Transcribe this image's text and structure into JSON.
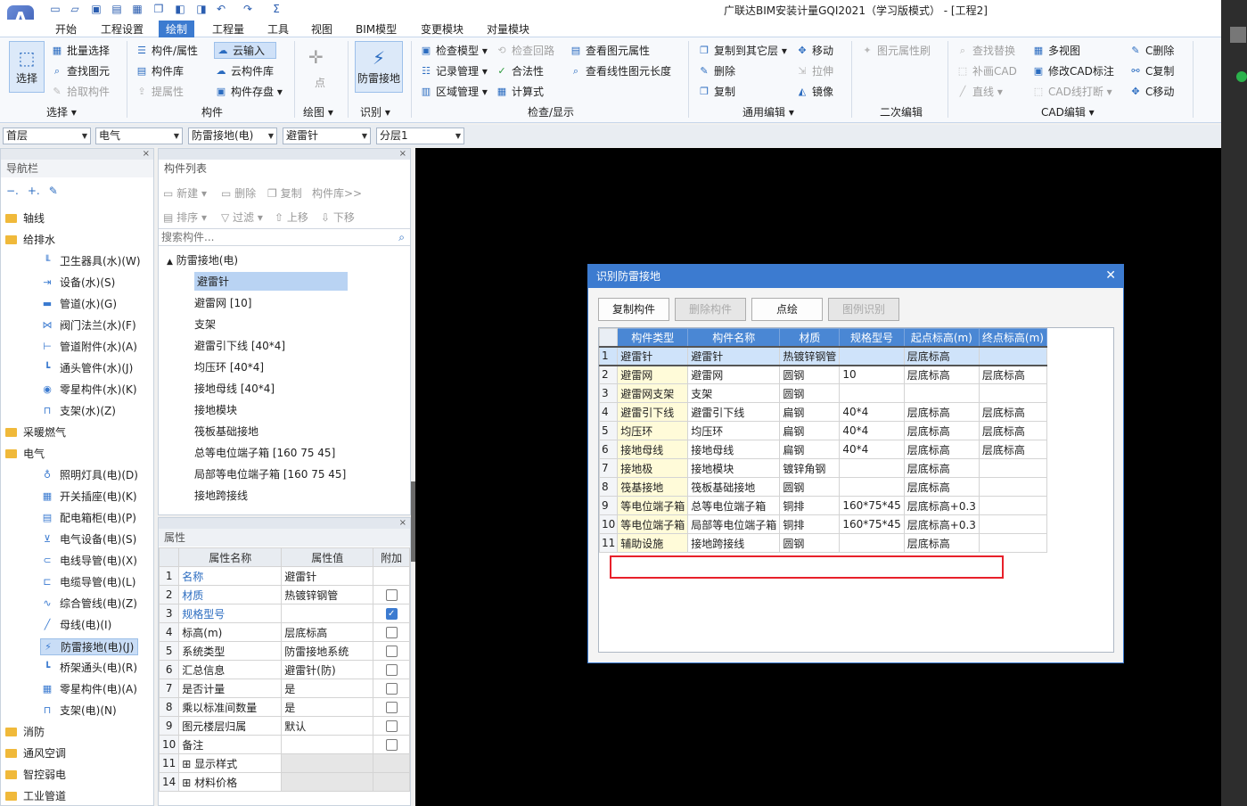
{
  "app": {
    "title": "广联达BIM安装计量GQI2021（学习版模式） - [工程2]",
    "logo": "A"
  },
  "quick_access_icons": [
    "new-icon",
    "open-icon",
    "save-icon",
    "cad-icon",
    "grid-icon",
    "copy-icon",
    "layer-icon",
    "undo-icon",
    "redo-icon",
    "sum-icon"
  ],
  "menu_tabs": [
    "开始",
    "工程设置",
    "绘制",
    "工程量",
    "工具",
    "视图",
    "BIM模型",
    "变更模块",
    "对量模块"
  ],
  "active_tab": "绘制",
  "ribbon": {
    "select_label": "选择",
    "batch_select": "批量选择",
    "find_element": "查找图元",
    "pick_component": "拾取构件",
    "group_select": "选择",
    "component_attr": "构件/属性",
    "component_lib": "构件库",
    "lift_attr": "提属性",
    "cloud_input": "云输入",
    "cloud_lib": "云构件库",
    "component_save": "构件存盘",
    "group_component": "构件",
    "point": "点",
    "group_draw": "绘图",
    "lightning_ground": "防雷接地",
    "group_identify": "识别",
    "check_model": "检查模型",
    "record_manage": "记录管理",
    "area_manage": "区域管理",
    "check_loop": "检查回路",
    "legality": "合法性",
    "calc_formula": "计算式",
    "view_elem_attr": "查看图元属性",
    "view_line_len": "查看线性图元长度",
    "group_check": "检查/显示",
    "copy_other_floor": "复制到其它层",
    "delete": "删除",
    "copy": "复制",
    "move": "移动",
    "stretch": "拉伸",
    "mirror": "镜像",
    "group_edit": "通用编辑",
    "elem_attr_brush": "图元属性刷",
    "group_second_edit": "二次编辑",
    "find_replace": "查找替换",
    "draw_cad": "补画CAD",
    "line": "直线",
    "multi_view": "多视图",
    "modify_cad_note": "修改CAD标注",
    "cad_break": "CAD线打断",
    "c_delete": "C删除",
    "c_copy": "C复制",
    "c_move": "C移动",
    "group_cad_edit": "CAD编辑"
  },
  "selectors": [
    "首层",
    "电气",
    "防雷接地(电)",
    "避雷针",
    "分层1"
  ],
  "nav": {
    "title": "导航栏",
    "items": [
      {
        "label": "轴线",
        "type": "folder"
      },
      {
        "label": "给排水",
        "type": "folder"
      },
      {
        "label": "卫生器具(水)(W)",
        "type": "item",
        "icon": "sanitary-icon"
      },
      {
        "label": "设备(水)(S)",
        "type": "item",
        "icon": "equipment-icon"
      },
      {
        "label": "管道(水)(G)",
        "type": "item",
        "icon": "pipe-icon"
      },
      {
        "label": "阀门法兰(水)(F)",
        "type": "item",
        "icon": "valve-icon"
      },
      {
        "label": "管道附件(水)(A)",
        "type": "item",
        "icon": "pipe-fitting-icon"
      },
      {
        "label": "通头管件(水)(J)",
        "type": "item",
        "icon": "tee-icon"
      },
      {
        "label": "零星构件(水)(K)",
        "type": "item",
        "icon": "misc-icon"
      },
      {
        "label": "支架(水)(Z)",
        "type": "item",
        "icon": "bracket-icon"
      },
      {
        "label": "采暖燃气",
        "type": "folder"
      },
      {
        "label": "电气",
        "type": "folder"
      },
      {
        "label": "照明灯具(电)(D)",
        "type": "item",
        "icon": "lamp-icon"
      },
      {
        "label": "开关插座(电)(K)",
        "type": "item",
        "icon": "switch-icon"
      },
      {
        "label": "配电箱柜(电)(P)",
        "type": "item",
        "icon": "panel-icon"
      },
      {
        "label": "电气设备(电)(S)",
        "type": "item",
        "icon": "electric-device-icon"
      },
      {
        "label": "电线导管(电)(X)",
        "type": "item",
        "icon": "wire-icon"
      },
      {
        "label": "电缆导管(电)(L)",
        "type": "item",
        "icon": "cable-icon"
      },
      {
        "label": "综合管线(电)(Z)",
        "type": "item",
        "icon": "pipeline-icon"
      },
      {
        "label": "母线(电)(I)",
        "type": "item",
        "icon": "busbar-icon"
      },
      {
        "label": "防雷接地(电)(J)",
        "type": "item",
        "icon": "lightning-icon",
        "selected": true
      },
      {
        "label": "桥架通头(电)(R)",
        "type": "item",
        "icon": "tray-icon"
      },
      {
        "label": "零星构件(电)(A)",
        "type": "item",
        "icon": "misc-grid-icon"
      },
      {
        "label": "支架(电)(N)",
        "type": "item",
        "icon": "bracket-icon"
      },
      {
        "label": "消防",
        "type": "folder"
      },
      {
        "label": "通风空调",
        "type": "folder"
      },
      {
        "label": "智控弱电",
        "type": "folder"
      },
      {
        "label": "工业管道",
        "type": "folder"
      }
    ]
  },
  "component_list": {
    "title": "构件列表",
    "toolbar1": [
      "新建",
      "删除",
      "复制",
      "构件库>>"
    ],
    "toolbar2": [
      "排序",
      "过滤",
      "上移",
      "下移"
    ],
    "search_placeholder": "搜索构件...",
    "root": "防雷接地(电)",
    "items": [
      "避雷针",
      "避雷网 [10]",
      "支架",
      "避雷引下线 [40*4]",
      "均压环 [40*4]",
      "接地母线 [40*4]",
      "接地模块",
      "筏板基础接地",
      "总等电位端子箱 [160 75 45]",
      "局部等电位端子箱 [160 75 45]",
      "接地跨接线"
    ],
    "selected": "避雷针"
  },
  "properties": {
    "title": "属性",
    "headers": [
      "属性名称",
      "属性值",
      "附加"
    ],
    "rows": [
      {
        "n": "1",
        "name": "名称",
        "value": "避雷针",
        "blue": true,
        "check": ""
      },
      {
        "n": "2",
        "name": "材质",
        "value": "热镀锌钢管",
        "blue": true,
        "check": "off"
      },
      {
        "n": "3",
        "name": "规格型号",
        "value": "",
        "blue": true,
        "check": "on"
      },
      {
        "n": "4",
        "name": "标高(m)",
        "value": "层底标高",
        "blue": false,
        "check": "off"
      },
      {
        "n": "5",
        "name": "系统类型",
        "value": "防雷接地系统",
        "blue": false,
        "check": "off"
      },
      {
        "n": "6",
        "name": "汇总信息",
        "value": "避雷针(防)",
        "blue": false,
        "check": "off"
      },
      {
        "n": "7",
        "name": "是否计量",
        "value": "是",
        "blue": false,
        "check": "off"
      },
      {
        "n": "8",
        "name": "乘以标准间数量",
        "value": "是",
        "blue": false,
        "check": "off"
      },
      {
        "n": "9",
        "name": "图元楼层归属",
        "value": "默认",
        "blue": false,
        "check": "off"
      },
      {
        "n": "10",
        "name": "备注",
        "value": "",
        "blue": false,
        "check": "off"
      },
      {
        "n": "11",
        "name": "显示样式",
        "value": "",
        "blue": false,
        "check": "",
        "expand": true
      },
      {
        "n": "14",
        "name": "材料价格",
        "value": "",
        "blue": false,
        "check": "",
        "expand": true
      }
    ]
  },
  "dialog": {
    "title": "识别防雷接地",
    "buttons": [
      {
        "label": "复制构件",
        "enabled": true
      },
      {
        "label": "删除构件",
        "enabled": false
      },
      {
        "label": "点绘",
        "enabled": true
      },
      {
        "label": "图例识别",
        "enabled": false
      }
    ],
    "headers": [
      "构件类型",
      "构件名称",
      "材质",
      "规格型号",
      "起点标高(m)",
      "终点标高(m)"
    ],
    "rows": [
      [
        "1",
        "避雷针",
        "避雷针",
        "热镀锌钢管",
        "",
        "层底标高",
        ""
      ],
      [
        "2",
        "避雷网",
        "避雷网",
        "圆钢",
        "10",
        "层底标高",
        "层底标高"
      ],
      [
        "3",
        "避雷网支架",
        "支架",
        "圆钢",
        "",
        "",
        ""
      ],
      [
        "4",
        "避雷引下线",
        "避雷引下线",
        "扁钢",
        "40*4",
        "层底标高",
        "层底标高"
      ],
      [
        "5",
        "均压环",
        "均压环",
        "扁钢",
        "40*4",
        "层底标高",
        "层底标高"
      ],
      [
        "6",
        "接地母线",
        "接地母线",
        "扁钢",
        "40*4",
        "层底标高",
        "层底标高"
      ],
      [
        "7",
        "接地极",
        "接地模块",
        "镀锌角钢",
        "",
        "层底标高",
        ""
      ],
      [
        "8",
        "筏基接地",
        "筏板基础接地",
        "圆钢",
        "",
        "层底标高",
        ""
      ],
      [
        "9",
        "等电位端子箱",
        "总等电位端子箱",
        "铜排",
        "160*75*45",
        "层底标高+0.3",
        ""
      ],
      [
        "10",
        "等电位端子箱",
        "局部等电位端子箱",
        "铜排",
        "160*75*45",
        "层底标高+0.3",
        ""
      ],
      [
        "11",
        "辅助设施",
        "接地跨接线",
        "圆钢",
        "",
        "层底标高",
        ""
      ]
    ],
    "highlight_color": "#e8202a"
  }
}
